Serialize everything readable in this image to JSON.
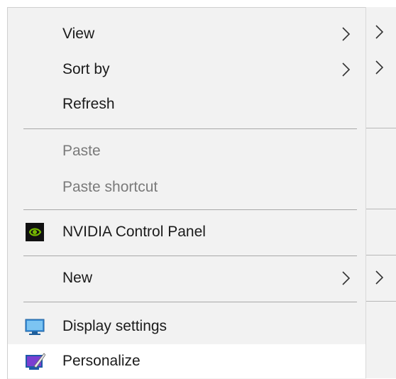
{
  "context_menu": {
    "items": [
      {
        "label": "View",
        "has_submenu": true,
        "enabled": true
      },
      {
        "label": "Sort by",
        "has_submenu": true,
        "enabled": true
      },
      {
        "label": "Refresh",
        "has_submenu": false,
        "enabled": true
      },
      {
        "label": "Paste",
        "has_submenu": false,
        "enabled": false
      },
      {
        "label": "Paste shortcut",
        "has_submenu": false,
        "enabled": false
      },
      {
        "label": "NVIDIA Control Panel",
        "icon": "nvidia-icon",
        "enabled": true
      },
      {
        "label": "New",
        "has_submenu": true,
        "enabled": true
      },
      {
        "label": "Display settings",
        "icon": "display-settings-icon",
        "enabled": true
      },
      {
        "label": "Personalize",
        "icon": "personalize-icon",
        "enabled": true,
        "highlighted": true
      }
    ]
  },
  "colors": {
    "menu_bg": "#f2f2f2",
    "separator": "#a8a8a8",
    "disabled_text": "#7a7a7a",
    "nvidia_green": "#76b900"
  }
}
